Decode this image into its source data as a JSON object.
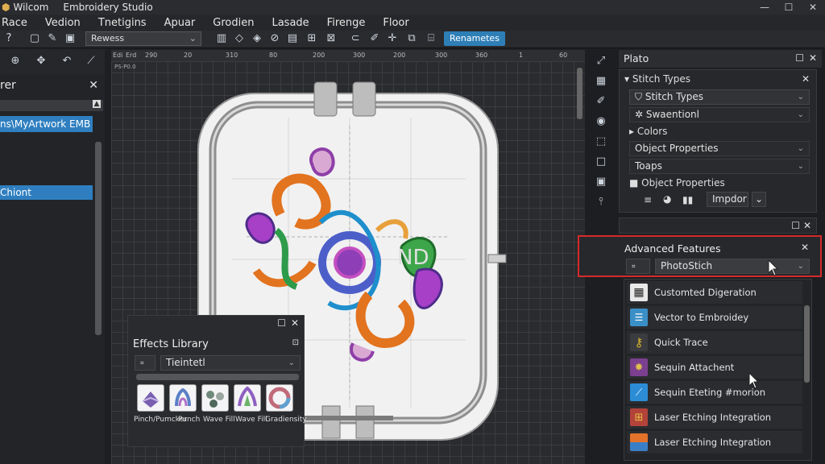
{
  "window": {
    "app_name": "Wilcom",
    "title": "Embroidery Studio",
    "controls": [
      "—",
      "☐",
      "✕"
    ]
  },
  "menu": [
    "Race",
    "Vedion",
    "Tnetigins",
    "Apuar",
    "Grodien",
    "Lasade",
    "Firenge",
    "Floor"
  ],
  "toolbar": {
    "preset_combo": "Rewess",
    "action_button": "Renametes"
  },
  "left_panel": {
    "title": "rer",
    "file_item": "ns\\MyArtwork EMB",
    "selected_item": "Chiont"
  },
  "ruler": {
    "labels": [
      "Edi",
      "Erd",
      "290",
      "20",
      "310",
      "80",
      "200",
      "300",
      "200",
      "300",
      "360",
      "1",
      "60"
    ],
    "corner": "PS-P0.0"
  },
  "canvas": {
    "hoop_watermark": "ND"
  },
  "right_panel": {
    "header_title": "Plato",
    "stitch_panel": {
      "title": "Stitch Types",
      "rows": [
        {
          "label": "Stitch Types",
          "type": "dropdown"
        },
        {
          "label": "Swaentionl",
          "type": "dropdown"
        },
        {
          "label": "Colors",
          "type": "tree"
        },
        {
          "label": "Object Properties",
          "type": "dropdown"
        },
        {
          "label": "Toaps",
          "type": "dropdown"
        },
        {
          "label": "Object Properties",
          "type": "tree"
        }
      ],
      "import_button": "Impdor"
    },
    "advanced": {
      "title": "Advanced Features",
      "combo_value": "PhotoStich",
      "items": [
        {
          "label": "Customted Digeration",
          "icon": "qr-icon",
          "color": "#e8e8e8"
        },
        {
          "label": "Vector to Embroidey",
          "icon": "vector-icon",
          "color": "#3a8fc6"
        },
        {
          "label": "Quick Trace",
          "icon": "key-icon",
          "color": "#d8b42a"
        },
        {
          "label": "Sequin Attachent",
          "icon": "sequin-icon",
          "color": "#7b3f8f"
        },
        {
          "label": "Sequin Eteting #morion",
          "icon": "laser-icon",
          "color": "#2c8dd6"
        },
        {
          "label": "Laser Etching Integration",
          "icon": "grid-icon",
          "color": "#b3433a"
        },
        {
          "label": "Laser Etching Integration",
          "icon": "stripe-icon",
          "color": "#e3722a"
        }
      ]
    }
  },
  "effects_library": {
    "title": "Effects Library",
    "combo": "Tieintetl",
    "effects": [
      {
        "label": "Pinch/Pumcker",
        "color": "#7a5fb0"
      },
      {
        "label": "Punch",
        "color": "#5a7fc6"
      },
      {
        "label": "Wave Fill",
        "color": "#6f8a7a"
      },
      {
        "label": "Wave Fill",
        "color": "#8e5fc0"
      },
      {
        "label": "Gradiensity",
        "color": "#c06a7a"
      }
    ]
  },
  "colors": {
    "accent": "#2f7fb7",
    "highlight": "#d42a2a",
    "selection": "#2f7fc0"
  }
}
